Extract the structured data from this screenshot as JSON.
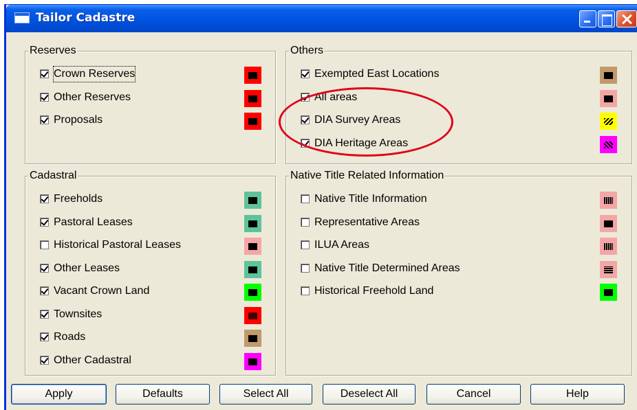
{
  "window": {
    "title": "Tailor Cadastre"
  },
  "groups": {
    "reserves": {
      "caption": "Reserves",
      "items": [
        {
          "label": "Crown Reserves",
          "checked": true,
          "color": "#ff0000",
          "pattern": "solid"
        },
        {
          "label": "Other Reserves",
          "checked": true,
          "color": "#ff0000",
          "pattern": "solid"
        },
        {
          "label": "Proposals",
          "checked": true,
          "color": "#ff0000",
          "pattern": "solid"
        }
      ]
    },
    "others": {
      "caption": "Others",
      "items": [
        {
          "label": "Exempted East Locations",
          "checked": true,
          "color": "#c19a6b",
          "pattern": "solid"
        },
        {
          "label": "All areas",
          "checked": true,
          "color": "#f4a6a6",
          "pattern": "solid"
        },
        {
          "label": "DIA Survey Areas",
          "checked": true,
          "color": "#ffff00",
          "pattern": "hatch-left"
        },
        {
          "label": "DIA Heritage Areas",
          "checked": true,
          "color": "#ff00ff",
          "pattern": "hatch-right"
        }
      ]
    },
    "cadastral": {
      "caption": "Cadastral",
      "items": [
        {
          "label": "Freeholds",
          "checked": true,
          "color": "#5fc39a",
          "pattern": "solid"
        },
        {
          "label": "Pastoral Leases",
          "checked": true,
          "color": "#5fc39a",
          "pattern": "solid"
        },
        {
          "label": "Historical Pastoral Leases",
          "checked": false,
          "color": "#f4a6a6",
          "pattern": "solid"
        },
        {
          "label": "Other Leases",
          "checked": true,
          "color": "#5fc39a",
          "pattern": "solid"
        },
        {
          "label": "Vacant Crown Land",
          "checked": true,
          "color": "#00ff00",
          "pattern": "solid"
        },
        {
          "label": "Townsites",
          "checked": true,
          "color": "#ff0000",
          "pattern": "dots"
        },
        {
          "label": "Roads",
          "checked": true,
          "color": "#c19a6b",
          "pattern": "solid"
        },
        {
          "label": "Other Cadastral",
          "checked": true,
          "color": "#ff00ff",
          "pattern": "solid"
        }
      ]
    },
    "native_title": {
      "caption": "Native Title Related Information",
      "items": [
        {
          "label": "Native Title Information",
          "checked": false,
          "color": "#f4a6a6",
          "pattern": "vertical"
        },
        {
          "label": "Representative Areas",
          "checked": false,
          "color": "#f4a6a6",
          "pattern": "solid"
        },
        {
          "label": "ILUA Areas",
          "checked": false,
          "color": "#f4a6a6",
          "pattern": "vertical"
        },
        {
          "label": "Native Title Determined Areas",
          "checked": false,
          "color": "#f4a6a6",
          "pattern": "horizontal"
        },
        {
          "label": "Historical Freehold Land",
          "checked": false,
          "color": "#00ff00",
          "pattern": "solid"
        }
      ]
    }
  },
  "buttons": {
    "apply": "Apply",
    "defaults": "Defaults",
    "select_all": "Select All",
    "deselect_all": "Deselect All",
    "cancel": "Cancel",
    "help": "Help"
  },
  "annotation": {
    "color": "#e0001a"
  }
}
